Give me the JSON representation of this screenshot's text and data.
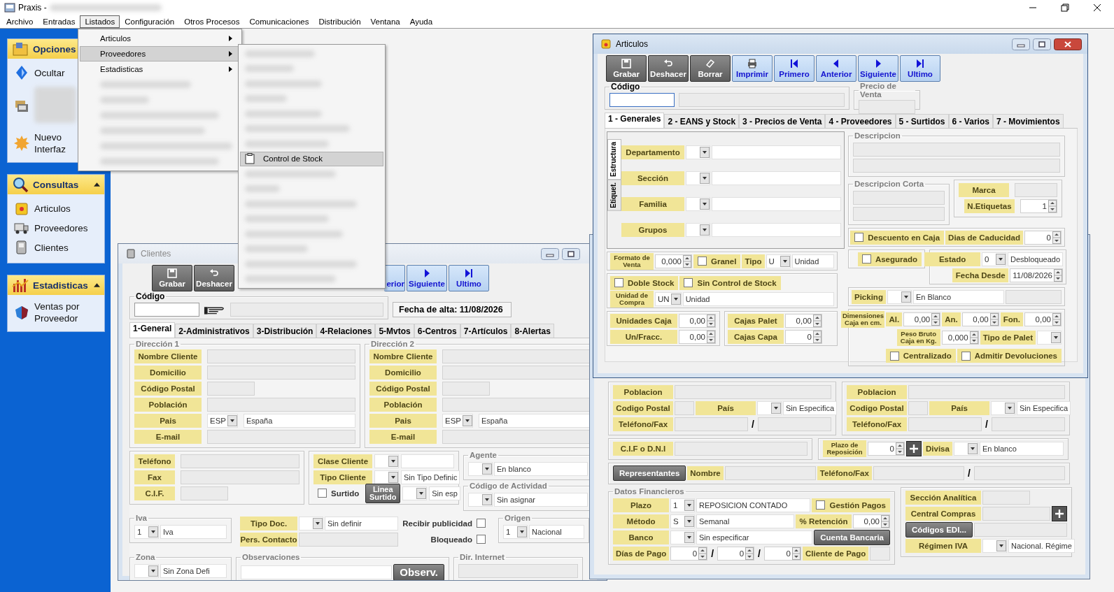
{
  "app": {
    "title": "Praxis -"
  },
  "menubar": [
    {
      "label": "Archivo",
      "selected": false
    },
    {
      "label": "Entradas",
      "selected": false
    },
    {
      "label": "Listados",
      "selected": true
    },
    {
      "label": "Configuración",
      "selected": false
    },
    {
      "label": "Otros Procesos",
      "selected": false
    },
    {
      "label": "Comunicaciones",
      "selected": false
    },
    {
      "label": "Distribución",
      "selected": false
    },
    {
      "label": "Ventana",
      "selected": false
    },
    {
      "label": "Ayuda",
      "selected": false
    }
  ],
  "listados_menu": [
    {
      "label": "Articulos",
      "selected": false
    },
    {
      "label": "Proveedores",
      "selected": true
    },
    {
      "label": "Estadisticas",
      "selected": false
    }
  ],
  "submenu": [
    {
      "label": "Control de Stock",
      "selected": true
    }
  ],
  "sidebar": [
    {
      "title": "Opciones",
      "items": [
        {
          "kind": "link",
          "label": "Ocultar"
        },
        {
          "kind": "blurred"
        },
        {
          "kind": "link",
          "label": "Nuevo Interfaz"
        }
      ]
    },
    {
      "title": "Consultas",
      "collapse_button": true,
      "items": [
        {
          "kind": "link",
          "label": "Articulos"
        },
        {
          "kind": "link",
          "label": "Proveedores"
        },
        {
          "kind": "link",
          "label": "Clientes"
        }
      ]
    },
    {
      "title": "Estadisticas",
      "collapse_button": true,
      "items": [
        {
          "kind": "link",
          "label": "Ventas por Proveedor"
        }
      ]
    }
  ],
  "articulos": {
    "title": "Articulos",
    "toolbar": [
      {
        "label": "Grabar",
        "kind": "save"
      },
      {
        "label": "Deshacer",
        "kind": "undo"
      },
      {
        "label": "Borrar",
        "kind": "erase"
      },
      {
        "label": "Imprimir",
        "kind": "print"
      },
      {
        "label": "Primero",
        "kind": "first"
      },
      {
        "label": "Anterior",
        "kind": "prev"
      },
      {
        "label": "Siguiente",
        "kind": "next"
      },
      {
        "label": "Ultimo",
        "kind": "last"
      }
    ],
    "codigo": {
      "legend": "Código"
    },
    "precio": {
      "legend": "Precio de Venta"
    },
    "tabs": [
      {
        "label": "1 - Generales",
        "selected": true
      },
      {
        "label": "2 - EANS y Stock",
        "selected": false
      },
      {
        "label": "3 - Precios de Venta",
        "selected": false
      },
      {
        "label": "4 - Proveedores",
        "selected": false
      },
      {
        "label": "5 - Surtidos",
        "selected": false
      },
      {
        "label": "6 - Varios",
        "selected": false
      },
      {
        "label": "7 - Movimientos",
        "selected": false
      }
    ],
    "side_tabs": [
      {
        "label": "Estructura",
        "selected": true
      },
      {
        "label": "Etiquet.",
        "selected": false
      }
    ],
    "estructura": {
      "lines": [
        {
          "items": [
            {
              "kind": "label",
              "text": "Departamento"
            },
            {
              "kind": "combo"
            },
            {
              "kind": "field"
            }
          ]
        },
        {
          "items": [
            {
              "kind": "label",
              "text": "Sección"
            },
            {
              "kind": "combo"
            },
            {
              "kind": "field"
            }
          ]
        },
        {
          "items": [
            {
              "kind": "label",
              "text": "Familia"
            },
            {
              "kind": "combo"
            },
            {
              "kind": "field"
            }
          ]
        },
        {
          "items": [
            {
              "kind": "label",
              "text": "Grupos"
            },
            {
              "kind": "combo"
            },
            {
              "kind": "field"
            }
          ]
        }
      ]
    },
    "formato": {
      "lines": [
        {
          "items": [
            {
              "kind": "small-label",
              "text": "Formato de Venta"
            },
            {
              "kind": "spin",
              "value": "0,000"
            },
            {
              "kind": "check",
              "text": "Granel",
              "checked": false
            },
            {
              "kind": "label",
              "text": "Tipo"
            },
            {
              "kind": "combo",
              "value": "U"
            },
            {
              "kind": "field",
              "value": "Unidad"
            }
          ]
        }
      ]
    },
    "stock": {
      "lines": [
        {
          "items": [
            {
              "kind": "check",
              "text": "Doble Stock",
              "checked": false
            },
            {
              "kind": "check",
              "text": "Sin Control de Stock",
              "checked": false
            }
          ]
        },
        {
          "items": [
            {
              "kind": "small-label",
              "text": "Unidad de Compra"
            },
            {
              "kind": "combo",
              "value": "UN"
            },
            {
              "kind": "field",
              "value": "Unidad"
            }
          ]
        }
      ]
    },
    "cajas": {
      "lines": [
        {
          "items": [
            {
              "kind": "label",
              "text": "Unidades Caja"
            },
            {
              "kind": "spin",
              "value": "0,00"
            }
          ]
        },
        {
          "items": [
            {
              "kind": "label",
              "text": "Un/Fracc."
            },
            {
              "kind": "spin",
              "value": "0,00"
            }
          ]
        }
      ]
    },
    "palet": {
      "lines": [
        {
          "items": [
            {
              "kind": "label",
              "text": "Cajas Palet"
            },
            {
              "kind": "spin",
              "value": "0,00"
            }
          ]
        },
        {
          "items": [
            {
              "kind": "label",
              "text": "Cajas Capa"
            },
            {
              "kind": "spin",
              "value": "0"
            }
          ]
        }
      ]
    },
    "descripcion": {
      "legend": "Descripcion",
      "lines": [
        {
          "items": [
            {
              "kind": "readonly"
            }
          ]
        },
        {
          "items": [
            {
              "kind": "readonly"
            }
          ]
        }
      ]
    },
    "descripcion_corta": {
      "legend": "Descripcion Corta",
      "lines": [
        {
          "items": [
            {
              "kind": "readonly"
            }
          ]
        },
        {
          "items": [
            {
              "kind": "readonly"
            }
          ]
        }
      ]
    },
    "marca": {
      "lines": [
        {
          "items": [
            {
              "kind": "label",
              "text": "Marca"
            },
            {
              "kind": "readonly"
            }
          ]
        },
        {
          "items": [
            {
              "kind": "label",
              "text": "N.Etiquetas"
            },
            {
              "kind": "spin",
              "value": "1"
            }
          ]
        }
      ]
    },
    "caducidad": {
      "lines": [
        {
          "items": [
            {
              "kind": "check",
              "text": "Descuento en Caja",
              "checked": false
            },
            {
              "kind": "label",
              "text": "Dias de Caducidad"
            },
            {
              "kind": "spin",
              "value": "0"
            }
          ]
        }
      ]
    },
    "asegurado": {
      "lines": [
        {
          "items": [
            {
              "kind": "check",
              "text": "Asegurado",
              "checked": false
            }
          ]
        }
      ]
    },
    "estado": {
      "lines": [
        {
          "items": [
            {
              "kind": "label",
              "text": "Estado"
            },
            {
              "kind": "combo",
              "value": "0"
            },
            {
              "kind": "field",
              "value": "Desbloqueado"
            }
          ]
        },
        {
          "items": [
            {
              "kind": "label",
              "text": "Fecha Desde"
            },
            {
              "kind": "spin",
              "value": "11/08/2026"
            }
          ]
        }
      ]
    },
    "picking": {
      "lines": [
        {
          "items": [
            {
              "kind": "label",
              "text": "Picking"
            },
            {
              "kind": "combo"
            },
            {
              "kind": "field",
              "value": "En Blanco"
            },
            {
              "kind": "readonly"
            }
          ]
        }
      ]
    },
    "dimensiones": {
      "lines": [
        {
          "items": [
            {
              "kind": "small-label",
              "text": "Dimensiones Caja en cm."
            },
            {
              "kind": "label",
              "text": "Al."
            },
            {
              "kind": "spin",
              "value": "0,00"
            },
            {
              "kind": "label",
              "text": "An."
            },
            {
              "kind": "spin",
              "value": "0,00"
            },
            {
              "kind": "label",
              "text": "Fon."
            },
            {
              "kind": "spin",
              "value": "0,00"
            }
          ]
        },
        {
          "items": [
            {
              "kind": "small-label",
              "text": "Peso Bruto Caja en Kg."
            },
            {
              "kind": "spin",
              "value": "0,000"
            },
            {
              "kind": "label",
              "text": "Tipo de Palet"
            },
            {
              "kind": "combo"
            }
          ]
        },
        {
          "items": [
            {
              "kind": "check",
              "text": "Centralizado",
              "checked": false
            },
            {
              "kind": "check",
              "text": "Admitir Devoluciones",
              "checked": false
            }
          ]
        }
      ]
    }
  },
  "clientes": {
    "title": "Clientes",
    "toolbar": [
      {
        "label": "Grabar",
        "kind": "save"
      },
      {
        "label": "Deshacer",
        "kind": "undo"
      },
      {
        "label": "erior",
        "kind": "partial"
      },
      {
        "label": "Siguiente",
        "kind": "next"
      },
      {
        "label": "Ultimo",
        "kind": "last"
      }
    ],
    "codigo": {
      "legend": "Código"
    },
    "fecha": "Fecha de alta: 11/08/2026",
    "tabs": [
      {
        "label": "1-General",
        "selected": true
      },
      {
        "label": "2-Administrativos",
        "selected": false
      },
      {
        "label": "3-Distribución",
        "selected": false
      },
      {
        "label": "4-Relaciones",
        "selected": false
      },
      {
        "label": "5-Mvtos",
        "selected": false
      },
      {
        "label": "6-Centros",
        "selected": false
      },
      {
        "label": "7-Artículos",
        "selected": false
      },
      {
        "label": "8-Alertas",
        "selected": false
      }
    ],
    "direccion1": {
      "legend": "Dirección 1",
      "lines": [
        {
          "items": [
            {
              "kind": "label",
              "text": "Nombre Cliente"
            },
            {
              "kind": "readonly"
            }
          ]
        },
        {
          "items": [
            {
              "kind": "label",
              "text": "Domicilio"
            },
            {
              "kind": "readonly"
            }
          ]
        },
        {
          "items": [
            {
              "kind": "label",
              "text": "Código Postal"
            },
            {
              "kind": "readonly-short"
            }
          ]
        },
        {
          "items": [
            {
              "kind": "label",
              "text": "Población"
            },
            {
              "kind": "readonly"
            }
          ]
        },
        {
          "items": [
            {
              "kind": "label",
              "text": "Pais"
            },
            {
              "kind": "combo",
              "value": "ESP"
            },
            {
              "kind": "field",
              "value": "España"
            }
          ]
        },
        {
          "items": [
            {
              "kind": "label",
              "text": "E-mail"
            },
            {
              "kind": "readonly"
            }
          ]
        }
      ]
    },
    "direccion2": {
      "legend": "Dirección 2",
      "lines": [
        {
          "items": [
            {
              "kind": "label",
              "text": "Nombre Cliente"
            },
            {
              "kind": "readonly"
            }
          ]
        },
        {
          "items": [
            {
              "kind": "label",
              "text": "Domicilio"
            },
            {
              "kind": "readonly"
            }
          ]
        },
        {
          "items": [
            {
              "kind": "label",
              "text": "Código Postal"
            },
            {
              "kind": "readonly-short"
            }
          ]
        },
        {
          "items": [
            {
              "kind": "label",
              "text": "Población"
            },
            {
              "kind": "readonly"
            }
          ]
        },
        {
          "items": [
            {
              "kind": "label",
              "text": "Pais"
            },
            {
              "kind": "combo",
              "value": "ESP"
            },
            {
              "kind": "field",
              "value": "España"
            }
          ]
        },
        {
          "items": [
            {
              "kind": "label",
              "text": "E-mail"
            },
            {
              "kind": "readonly"
            }
          ]
        }
      ]
    },
    "contacto": {
      "lines": [
        {
          "items": [
            {
              "kind": "label",
              "text": "Teléfono"
            },
            {
              "kind": "readonly"
            }
          ]
        },
        {
          "items": [
            {
              "kind": "label",
              "text": "Fax"
            },
            {
              "kind": "readonly"
            }
          ]
        },
        {
          "items": [
            {
              "kind": "label",
              "text": "C.I.F."
            },
            {
              "kind": "readonly-short"
            }
          ]
        }
      ]
    },
    "clase": {
      "lines": [
        {
          "items": [
            {
              "kind": "label",
              "text": "Clase Cliente"
            },
            {
              "kind": "combo"
            },
            {
              "kind": "field"
            }
          ]
        },
        {
          "items": [
            {
              "kind": "label",
              "text": "Tipo Cliente"
            },
            {
              "kind": "combo"
            },
            {
              "kind": "field",
              "value": "Sin Tipo Definic"
            }
          ]
        },
        {
          "items": [
            {
              "kind": "plain-check",
              "text": "Surtido",
              "checked": false
            },
            {
              "kind": "button",
              "text": "Linea Surtido"
            },
            {
              "kind": "combo"
            },
            {
              "kind": "field",
              "value": "Sin esp"
            }
          ]
        }
      ]
    },
    "agente": {
      "legend": "Agente",
      "lines": [
        {
          "items": [
            {
              "kind": "combo"
            },
            {
              "kind": "field",
              "value": "En blanco"
            }
          ]
        }
      ]
    },
    "actividad": {
      "legend": "Código de Actividad",
      "lines": [
        {
          "items": [
            {
              "kind": "combo"
            },
            {
              "kind": "field",
              "value": "Sin asignar"
            }
          ]
        }
      ]
    },
    "iva": {
      "legend": "Iva",
      "lines": [
        {
          "items": [
            {
              "kind": "combo",
              "value": "1"
            },
            {
              "kind": "field",
              "value": "Iva"
            }
          ]
        }
      ]
    },
    "doc": {
      "lines": [
        {
          "items": [
            {
              "kind": "label",
              "text": "Tipo Doc."
            },
            {
              "kind": "combo"
            },
            {
              "kind": "field",
              "value": "Sin definir"
            }
          ]
        },
        {
          "items": [
            {
              "kind": "label",
              "text": "Pers. Contacto"
            },
            {
              "kind": "readonly"
            }
          ]
        }
      ]
    },
    "flags": {
      "lines": [
        {
          "items": [
            {
              "kind": "check-after",
              "text": "Recibir publicidad",
              "checked": false
            }
          ]
        },
        {
          "items": [
            {
              "kind": "check-after",
              "text": "Bloqueado",
              "checked": false
            }
          ]
        }
      ]
    },
    "origen": {
      "legend": "Origen",
      "lines": [
        {
          "items": [
            {
              "kind": "combo",
              "value": "1"
            },
            {
              "kind": "field",
              "value": "Nacional"
            }
          ]
        }
      ]
    },
    "zona": {
      "legend": "Zona",
      "lines": [
        {
          "items": [
            {
              "kind": "combo"
            },
            {
              "kind": "field",
              "value": "Sin Zona Defi"
            }
          ]
        }
      ]
    },
    "observaciones": {
      "legend": "Observaciones",
      "lines": [
        {
          "items": [
            {
              "kind": "field"
            },
            {
              "kind": "button",
              "text": "Observ."
            }
          ]
        }
      ]
    },
    "internet": {
      "legend": "Dir. Internet",
      "lines": [
        {
          "items": [
            {
              "kind": "readonly"
            }
          ]
        }
      ]
    }
  },
  "proveedores": {
    "direccion_a": {
      "lines": [
        {
          "items": [
            {
              "kind": "label",
              "text": "Poblacion"
            },
            {
              "kind": "readonly"
            }
          ]
        },
        {
          "items": [
            {
              "kind": "label",
              "text": "Codigo Postal"
            },
            {
              "kind": "readonly"
            },
            {
              "kind": "label",
              "text": "País"
            },
            {
              "kind": "combo"
            },
            {
              "kind": "field",
              "value": "Sin Especifica"
            }
          ]
        },
        {
          "items": [
            {
              "kind": "label",
              "text": "Teléfono/Fax"
            },
            {
              "kind": "readonly"
            },
            {
              "kind": "slash",
              "text": "/"
            },
            {
              "kind": "readonly"
            }
          ]
        }
      ]
    },
    "direccion_b": {
      "lines": [
        {
          "items": [
            {
              "kind": "label",
              "text": "Poblacion"
            },
            {
              "kind": "readonly"
            }
          ]
        },
        {
          "items": [
            {
              "kind": "label",
              "text": "Codigo Postal"
            },
            {
              "kind": "readonly"
            },
            {
              "kind": "label",
              "text": "País"
            },
            {
              "kind": "combo"
            },
            {
              "kind": "field",
              "value": "Sin Especifica"
            }
          ]
        },
        {
          "items": [
            {
              "kind": "label",
              "text": "Teléfono/Fax"
            },
            {
              "kind": "readonly"
            },
            {
              "kind": "slash",
              "text": "/"
            },
            {
              "kind": "readonly"
            }
          ]
        }
      ]
    },
    "cif": {
      "lines": [
        {
          "items": [
            {
              "kind": "label",
              "text": "C.I.F o D.N.I"
            },
            {
              "kind": "readonly"
            }
          ]
        }
      ]
    },
    "reposicion": {
      "lines": [
        {
          "items": [
            {
              "kind": "small-label",
              "text": "Plazo de Reposición"
            },
            {
              "kind": "spin",
              "value": "0"
            },
            {
              "kind": "plus"
            },
            {
              "kind": "label",
              "text": "Divisa"
            },
            {
              "kind": "combo"
            },
            {
              "kind": "field",
              "value": "En blanco"
            }
          ]
        }
      ]
    },
    "representantes": {
      "lines": [
        {
          "items": [
            {
              "kind": "button",
              "text": "Representantes"
            },
            {
              "kind": "label",
              "text": "Nombre"
            },
            {
              "kind": "readonly"
            },
            {
              "kind": "label",
              "text": "Teléfono/Fax"
            },
            {
              "kind": "readonly"
            },
            {
              "kind": "slash",
              "text": "/"
            },
            {
              "kind": "readonly"
            }
          ]
        }
      ]
    },
    "financieros": {
      "legend": "Datos Financieros",
      "lines": [
        {
          "items": [
            {
              "kind": "label",
              "text": "Plazo"
            },
            {
              "kind": "combo",
              "value": "1"
            },
            {
              "kind": "field",
              "value": "REPOSICION CONTADO"
            },
            {
              "kind": "check",
              "text": "Gestión Pagos",
              "checked": false
            }
          ]
        },
        {
          "items": [
            {
              "kind": "label",
              "text": "Método"
            },
            {
              "kind": "combo",
              "value": "S"
            },
            {
              "kind": "field",
              "value": "Semanal"
            },
            {
              "kind": "label",
              "text": "% Retención"
            },
            {
              "kind": "spin",
              "value": "0,00"
            }
          ]
        },
        {
          "items": [
            {
              "kind": "label",
              "text": "Banco"
            },
            {
              "kind": "combo"
            },
            {
              "kind": "field",
              "value": "Sin especificar"
            },
            {
              "kind": "button",
              "text": "Cuenta Bancaria"
            }
          ]
        },
        {
          "items": [
            {
              "kind": "label",
              "text": "Días de Pago"
            },
            {
              "kind": "spin",
              "value": "0"
            },
            {
              "kind": "slash",
              "text": "/"
            },
            {
              "kind": "spin",
              "value": "0"
            },
            {
              "kind": "slash",
              "text": "/"
            },
            {
              "kind": "spin",
              "value": "0"
            },
            {
              "kind": "label",
              "text": "Cliente de Pago"
            },
            {
              "kind": "readonly"
            }
          ]
        }
      ]
    },
    "analitica": {
      "lines": [
        {
          "items": [
            {
              "kind": "label",
              "text": "Sección Analítica"
            },
            {
              "kind": "readonly-short"
            }
          ]
        },
        {
          "items": [
            {
              "kind": "label",
              "text": "Central Compras"
            },
            {
              "kind": "readonly"
            },
            {
              "kind": "plus"
            }
          ]
        },
        {
          "items": [
            {
              "kind": "button",
              "text": "Códigos EDI..."
            },
            {
              "kind": "readonly"
            }
          ]
        },
        {
          "items": [
            {
              "kind": "label",
              "text": "Régimen IVA"
            },
            {
              "kind": "combo"
            },
            {
              "kind": "field",
              "value": "Nacional. Régime"
            }
          ]
        }
      ]
    }
  }
}
